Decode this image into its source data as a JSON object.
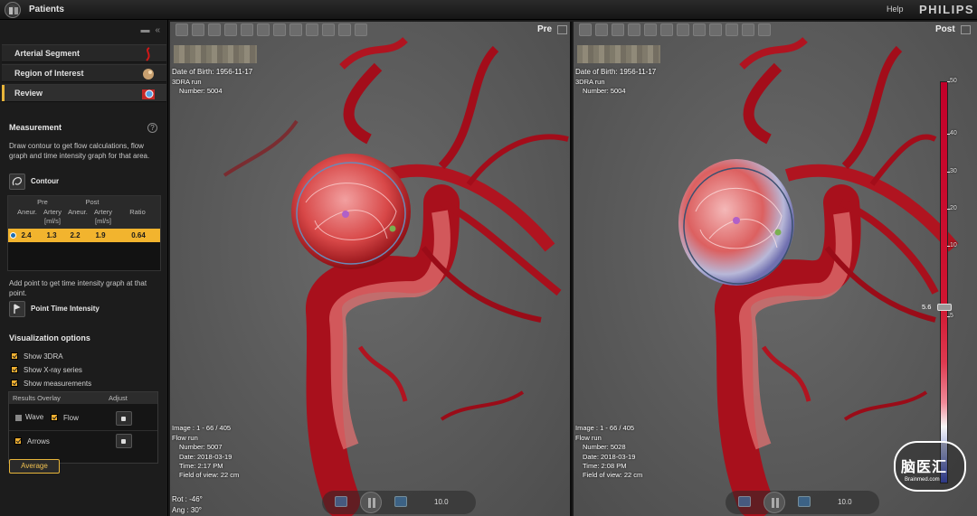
{
  "topbar": {
    "title": "Patients",
    "help": "Help",
    "brand": "PHILIPS"
  },
  "steps": [
    {
      "label": "Arterial Segment",
      "icon": "vessel-icon"
    },
    {
      "label": "Region of Interest",
      "icon": "roi-icon"
    },
    {
      "label": "Review",
      "icon": "review-icon",
      "active": true
    }
  ],
  "measurement": {
    "title": "Measurement",
    "help": "?",
    "description": "Draw contour to get flow calculations, flow graph and time intensity graph for that area.",
    "contour_label": "Contour",
    "table": {
      "group_pre": "Pre",
      "group_post": "Post",
      "col_aneur": "Aneur.",
      "col_artery": "Artery",
      "col_units": "[ml/s]",
      "col_ratio": "Ratio",
      "row": {
        "pre_aneur": "2.4",
        "pre_artery": "1.3",
        "post_aneur": "2.2",
        "post_artery": "1.9",
        "ratio": "0.64"
      }
    },
    "point_desc": "Add point to get time intensity graph at that point.",
    "point_tool_label": "Point Time Intensity"
  },
  "visualization": {
    "title": "Visualization options",
    "options": [
      "Show 3DRA",
      "Show X-ray series",
      "Show measurements"
    ],
    "results": {
      "header_overlay": "Results Overlay",
      "header_adjust": "Adjust",
      "wave": "Wave",
      "flow": "Flow",
      "arrows": "Arrows"
    },
    "average_button": "Average"
  },
  "viewports": {
    "pre": {
      "tag": "Pre",
      "dob": "Date of Birth:  1956-11-17",
      "run": "3DRA run",
      "run_number": "Number:      5004",
      "image": "Image :         1 - 66 / 405",
      "flow_run": "Flow run",
      "number": "Number:      5007",
      "date": "Date:           2018-03-19",
      "time": "Time:           2:17 PM",
      "fov": "Field of view:   22 cm",
      "rot": "Rot : -46°",
      "ang": "Ang : 30°",
      "speed": "10.0"
    },
    "post": {
      "tag": "Post",
      "dob": "Date of Birth:  1956-11-17",
      "run": "3DRA run",
      "run_number": "Number:      5004",
      "image": "Image :         1 - 66 / 405",
      "flow_run": "Flow run",
      "number": "Number:      5028",
      "date": "Date:           2018-03-19",
      "time": "Time:           2:08 PM",
      "fov": "Field of view:   22 cm",
      "speed": "10.0"
    }
  },
  "colorbar": {
    "ticks": [
      "50",
      "40",
      "30",
      "20",
      "10",
      "5"
    ],
    "handle_value": "5.6"
  },
  "watermark": {
    "text": "脑医汇",
    "sub": "Brainmed.com"
  }
}
